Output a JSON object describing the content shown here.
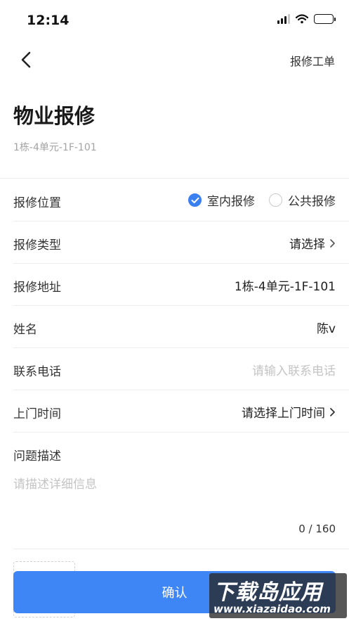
{
  "status_bar": {
    "time": "12:14",
    "battery_level": 0.3
  },
  "nav": {
    "right_link": "报修工单"
  },
  "header": {
    "title": "物业报修",
    "subtitle": "1栋-4单元-1F-101"
  },
  "form": {
    "location": {
      "label": "报修位置",
      "options": [
        {
          "label": "室内报修",
          "checked": true
        },
        {
          "label": "公共报修",
          "checked": false
        }
      ]
    },
    "type": {
      "label": "报修类型",
      "value": "请选择"
    },
    "address": {
      "label": "报修地址",
      "value": "1栋-4单元-1F-101"
    },
    "name": {
      "label": "姓名",
      "value": "陈v"
    },
    "phone": {
      "label": "联系电话",
      "placeholder": "请输入联系电话"
    },
    "visit_time": {
      "label": "上门时间",
      "value": "请选择上门时间"
    },
    "description": {
      "label": "问题描述",
      "placeholder": "请描述详细信息",
      "counter": "0 / 160"
    }
  },
  "submit": {
    "label": "确认"
  },
  "watermark": {
    "title": "下载岛应用",
    "url": "www.xiazaidao.com"
  },
  "colors": {
    "accent": "#3e86f6",
    "divider": "#eeeeee",
    "placeholder": "#c4c4c4"
  }
}
